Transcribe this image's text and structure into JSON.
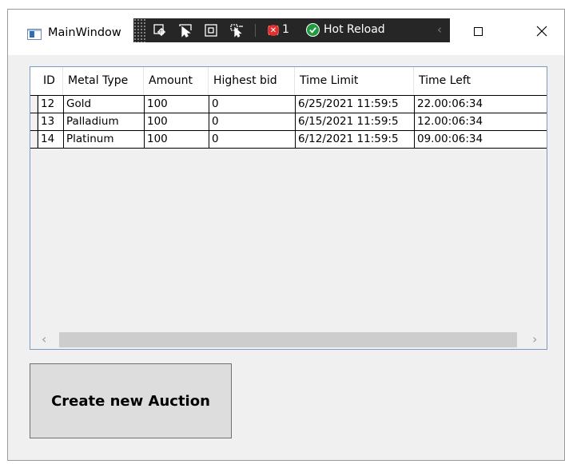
{
  "window": {
    "title": "MainWindow"
  },
  "devbar": {
    "error_count": "1",
    "hot_reload_label": "Hot Reload",
    "icons": [
      "select-element-icon",
      "select-pointer-icon",
      "display-layout-adorners-icon",
      "track-focus-icon",
      "binding-failures-icon",
      "hot-reload-ok-icon"
    ]
  },
  "grid": {
    "columns": [
      "ID",
      "Metal Type",
      "Amount",
      "Highest bid",
      "Time Limit",
      "Time Left"
    ],
    "rows": [
      [
        "12",
        "Gold",
        "100",
        "0",
        "6/25/2021 11:59:5",
        "22.00:06:34"
      ],
      [
        "13",
        "Palladium",
        "100",
        "0",
        "6/15/2021 11:59:5",
        "12.00:06:34"
      ],
      [
        "14",
        "Platinum",
        "100",
        "0",
        "6/12/2021 11:59:5",
        "09.00:06:34"
      ]
    ]
  },
  "actions": {
    "create_label": "Create new Auction"
  },
  "colors": {
    "window_bg": "#f0f0f0",
    "grid_border": "#7a9cc0",
    "devbar_bg": "#262626",
    "ok_green": "#1f9c3f",
    "error_red": "#e03030"
  }
}
